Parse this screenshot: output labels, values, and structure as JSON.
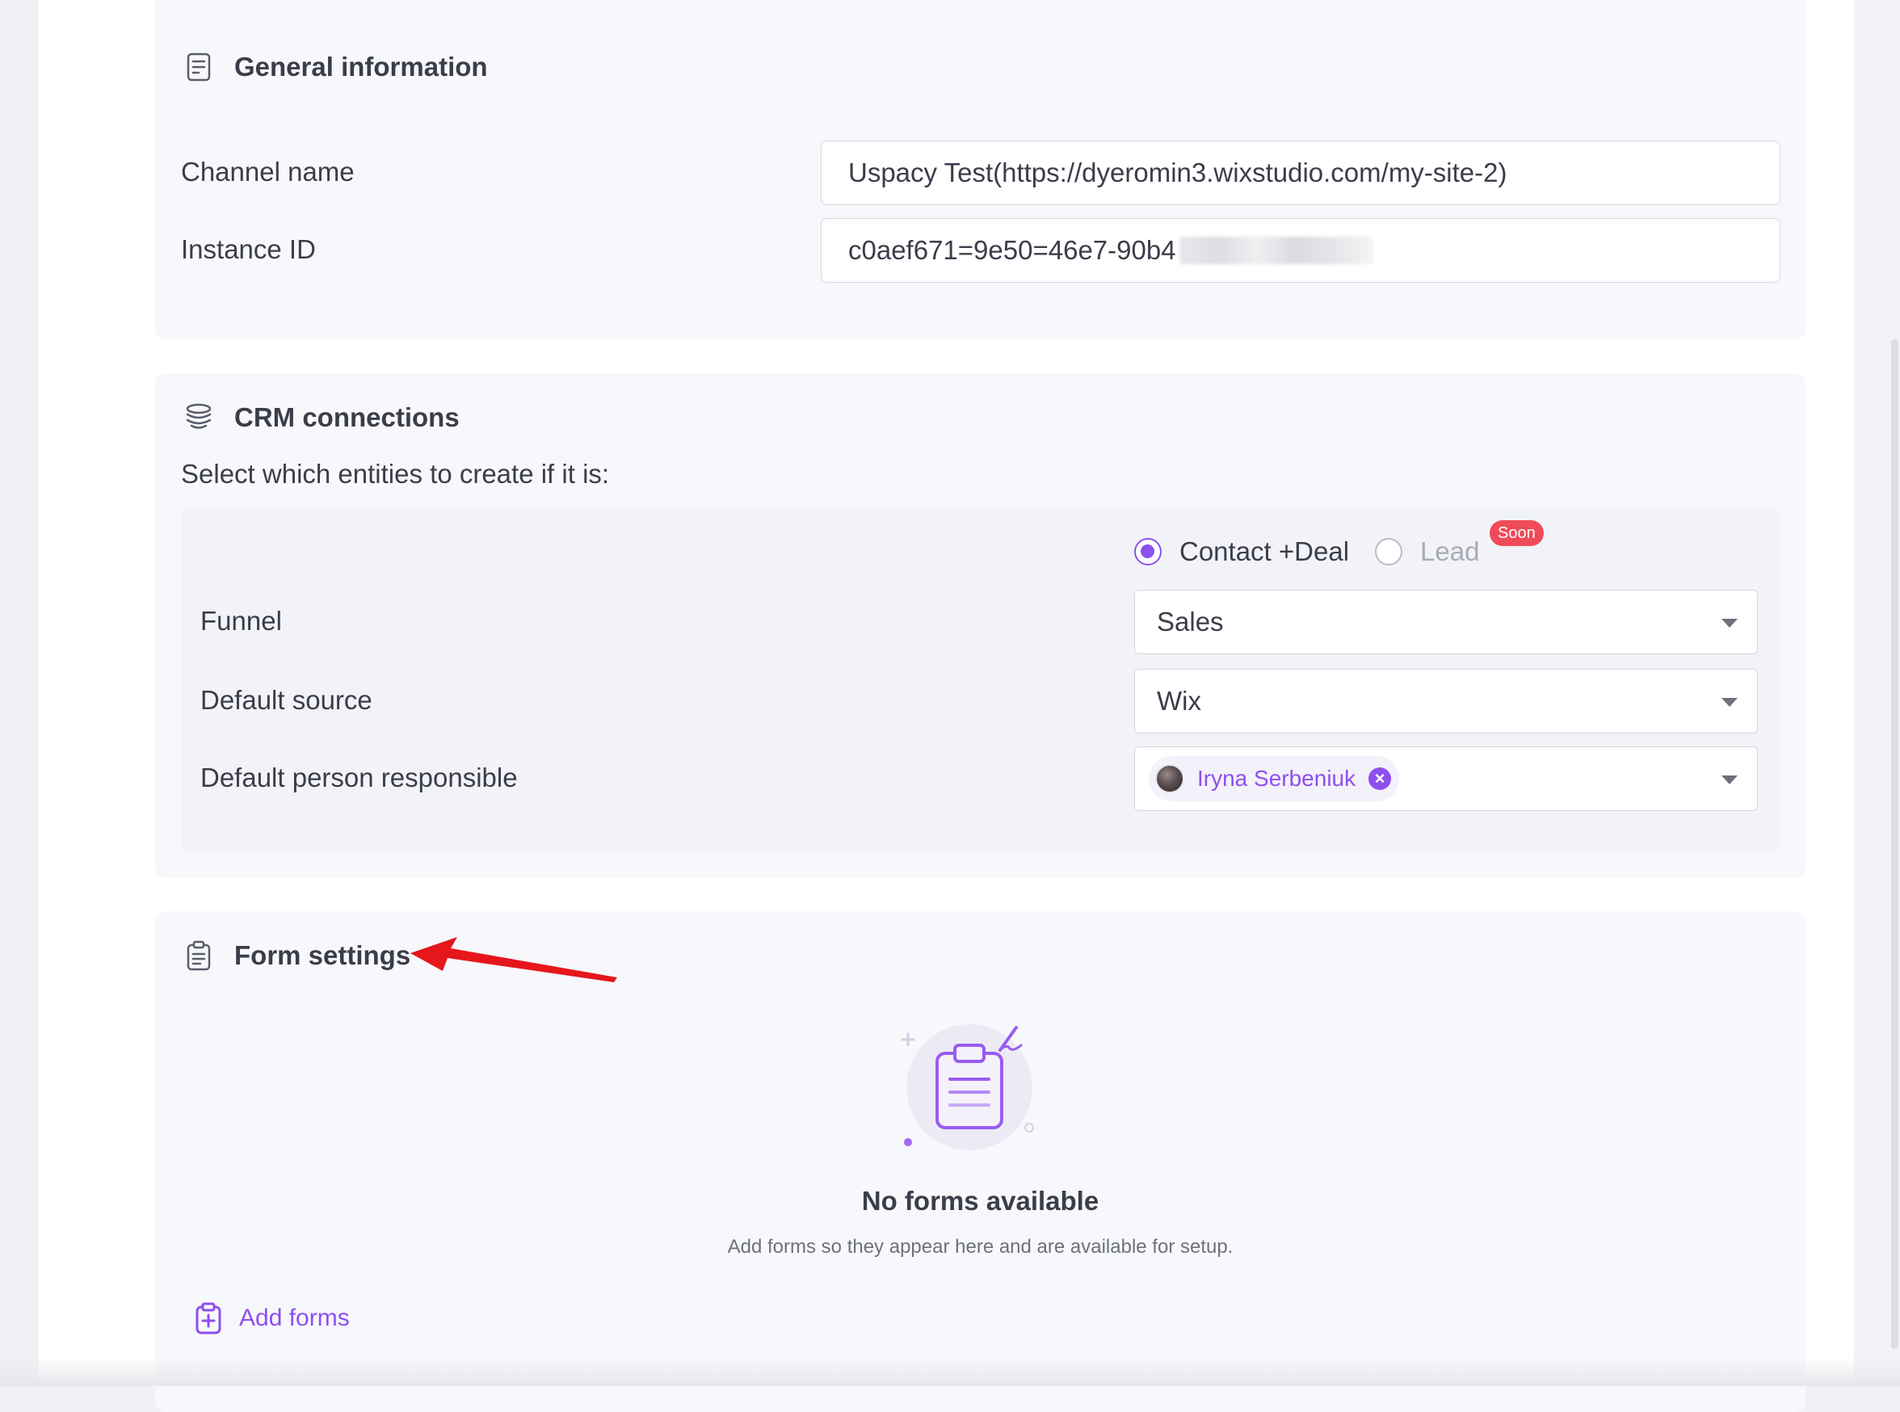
{
  "general": {
    "title": "General information",
    "channel_name_label": "Channel name",
    "channel_name_value": "Uspacy Test(https://dyeromin3.wixstudio.com/my-site-2)",
    "instance_id_label": "Instance ID",
    "instance_id_value": "c0aef671=9e50=46e7-90b4"
  },
  "crm": {
    "title": "CRM connections",
    "subtitle": "Select which entities to create if it is:",
    "options": [
      {
        "label": "Contact +Deal",
        "checked": true
      },
      {
        "label": "Lead",
        "checked": false,
        "disabled": true
      }
    ],
    "soon_badge": "Soon",
    "funnel_label": "Funnel",
    "funnel_value": "Sales",
    "source_label": "Default source",
    "source_value": "Wix",
    "responsible_label": "Default person responsible",
    "responsible_value": "Iryna Serbeniuk"
  },
  "forms": {
    "title": "Form settings",
    "empty_title": "No forms available",
    "empty_subtitle": "Add forms so they appear here and are available for setup.",
    "add_label": "Add forms"
  },
  "colors": {
    "accent": "#8e4ff0",
    "badge": "#ef4b58",
    "annotation_arrow": "#e5161c"
  }
}
